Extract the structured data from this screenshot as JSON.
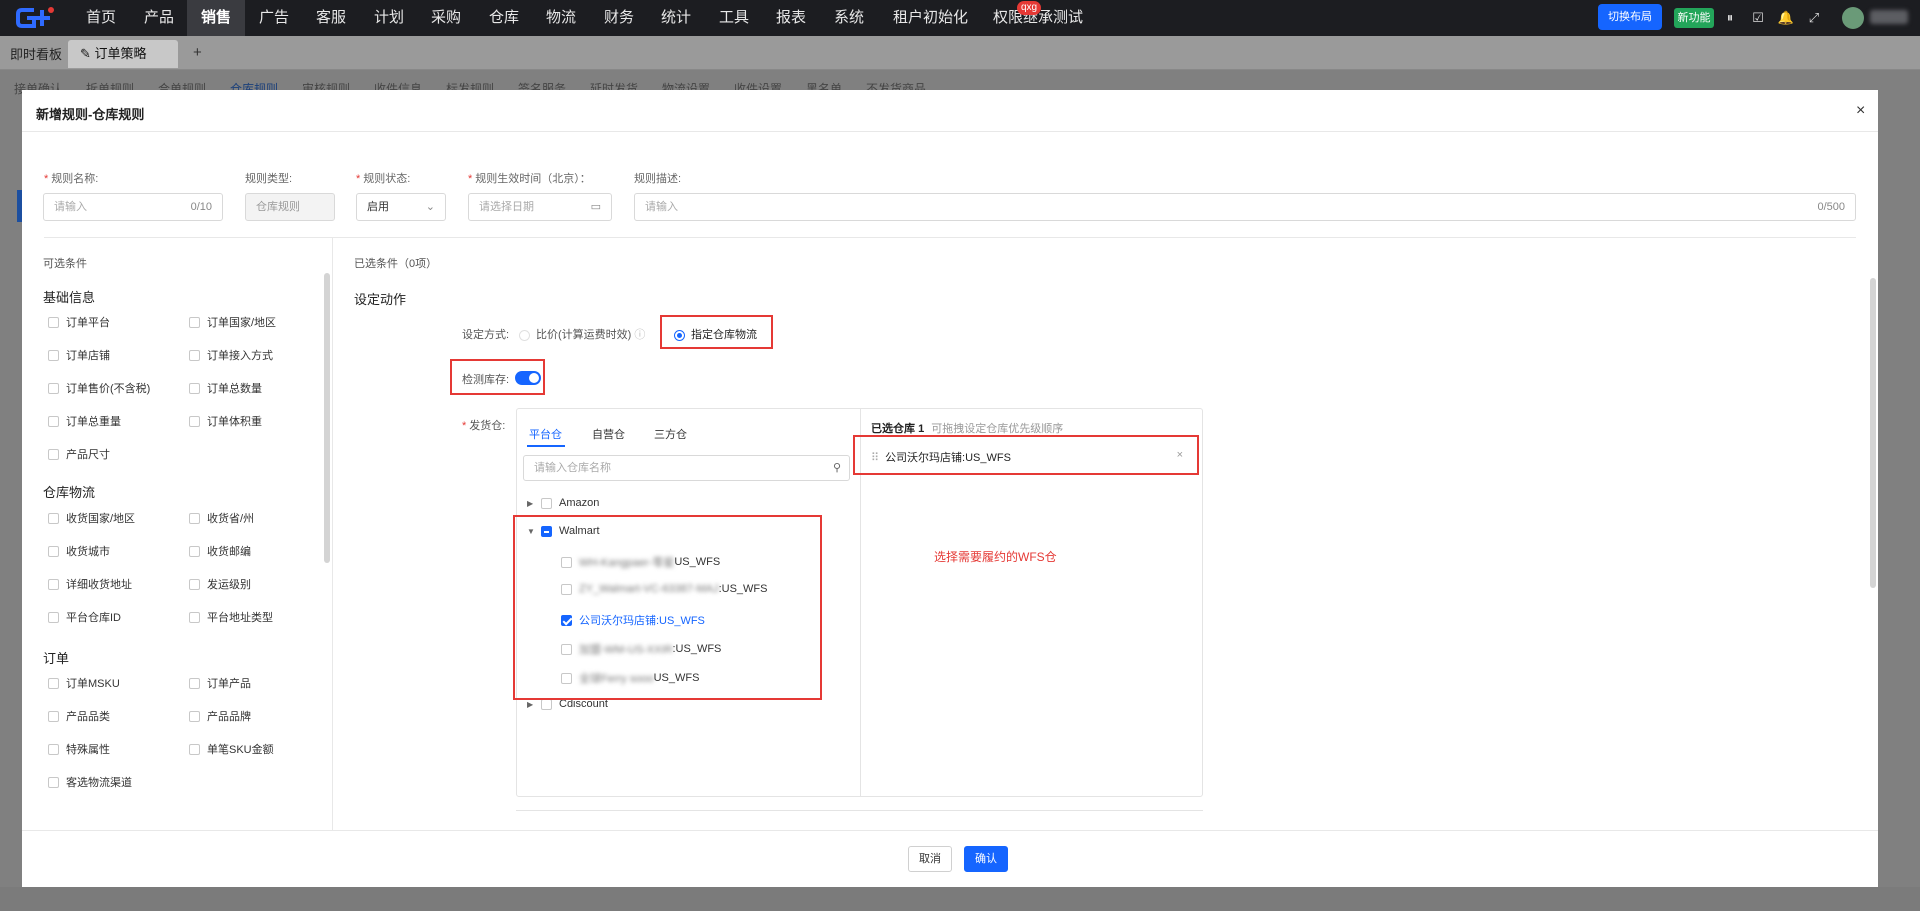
{
  "topnav": {
    "logo": "logo-icon",
    "items": [
      "首页",
      "产品",
      "销售",
      "广告",
      "客服",
      "计划",
      "采购",
      "仓库",
      "物流",
      "财务",
      "统计",
      "工具",
      "报表",
      "系统",
      "租户初始化",
      "权限继承测试"
    ],
    "active_index": 2,
    "badge": "qxg",
    "switch_layout": "切换布局",
    "new_func": "新功能",
    "icons": [
      "pause-icon",
      "check-box-icon",
      "bell-icon",
      "fullscreen-icon"
    ]
  },
  "tabs": {
    "dashboard": "即时看板",
    "current": "订单策略",
    "add": "+"
  },
  "subtabs": [
    "接单确认",
    "拆单规则",
    "合单规则",
    "仓库规则",
    "审核规则",
    "收件信息",
    "标发规则",
    "签名服务",
    "延时发货",
    "物流设置",
    "收件设置",
    "黑名单",
    "不发货商品"
  ],
  "subtab_active": 3,
  "modal": {
    "title": "新增规则-仓库规则",
    "close": "×",
    "fields": {
      "rule_name_label": "规则名称:",
      "rule_name_placeholder": "请输入",
      "rule_name_counter": "0/10",
      "rule_type_label": "规则类型:",
      "rule_type_value": "仓库规则",
      "rule_status_label": "规则状态:",
      "rule_status_value": "启用",
      "effective_time_label": "规则生效时间（北京）：",
      "effective_time_placeholder": "请选择日期",
      "desc_label": "规则描述:",
      "desc_placeholder": "请输入",
      "desc_counter": "0/500"
    },
    "left": {
      "title": "可选条件",
      "sections": [
        {
          "title": "基础信息",
          "items": [
            "订单平台",
            "订单国家/地区",
            "订单店铺",
            "订单接入方式",
            "订单售价(不含税)",
            "订单总数量",
            "订单总重量",
            "订单体积重",
            "产品尺寸"
          ]
        },
        {
          "title": "仓库物流",
          "items": [
            "收货国家/地区",
            "收货省/州",
            "收货城市",
            "收货邮编",
            "详细收货地址",
            "发运级别",
            "平台仓库ID",
            "平台地址类型"
          ]
        },
        {
          "title": "订单",
          "items": [
            "订单MSKU",
            "订单产品",
            "产品品类",
            "产品品牌",
            "特殊属性",
            "单笔SKU金额",
            "客选物流渠道"
          ]
        }
      ]
    },
    "right": {
      "selected_conditions": "已选条件（0项）",
      "action_title": "设定动作",
      "mode_label": "设定方式:",
      "mode_option1": "比价(计算运费时效)",
      "mode_option2": "指定仓库物流",
      "mode_selected": 2,
      "stock_check_label": "检测库存:",
      "stock_check_on": true,
      "warehouse_label": "发货仓:",
      "wh_tabs": [
        "平台仓",
        "自营仓",
        "三方仓"
      ],
      "wh_tab_active": 0,
      "wh_search_placeholder": "请输入仓库名称",
      "tree": {
        "amazon": "Amazon",
        "walmart": "Walmart",
        "children": [
          {
            "blurred": "WH-Kangpaer-零星",
            "suffix": "US_WFS",
            "checked": false
          },
          {
            "blurred": "ZY_Walmart-VC-63387-MAJ",
            "suffix": ":US_WFS",
            "checked": false
          },
          {
            "text": "公司沃尔玛店铺:US_WFS",
            "checked": true
          },
          {
            "blurred": "加盟-WM-US-XXIR",
            "suffix": ":US_WFS",
            "checked": false
          },
          {
            "blurred": "全球Ferry sooo",
            "suffix": "US_WFS",
            "checked": false
          }
        ],
        "cdiscount": "Cdiscount"
      },
      "selected_head_prefix": "已选仓库",
      "selected_head_count": "1",
      "selected_head_hint": "可拖拽设定仓库优先级顺序",
      "selected_item": "公司沃尔玛店铺:US_WFS",
      "annotation": "选择需要履约的WFS仓"
    },
    "footer": {
      "cancel": "取消",
      "confirm": "确认"
    }
  },
  "colors": {
    "primary": "#1565ff",
    "annotation_red": "#e53935",
    "nav_bg": "#1c1d21",
    "new_func_green": "#23a55a"
  }
}
